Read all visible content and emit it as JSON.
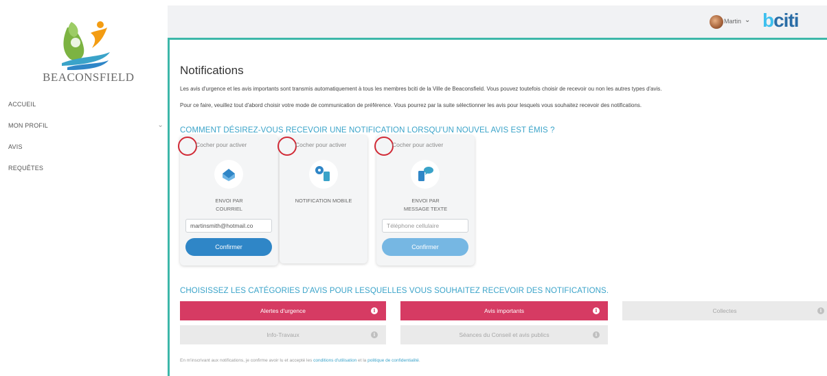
{
  "sidebar": {
    "logo_text": "BEACONSFIELD",
    "items": [
      {
        "label": "ACCUEIL"
      },
      {
        "label": "MON PROFIL"
      },
      {
        "label": "AVIS"
      },
      {
        "label": "REQUÊTES"
      }
    ]
  },
  "header": {
    "user_name": "Martin",
    "brand": {
      "b": "b",
      "rest": "citi"
    }
  },
  "main": {
    "title": "Notifications",
    "intro_line1": "Les avis d'urgence et les avis importants sont transmis automatiquement à tous les membres bciti de la Ville de Beaconsfield. Vous pouvez toutefois choisir de recevoir ou non les autres types d'avis.",
    "intro_line2": "Pour ce faire, veuillez tout d'abord choisir votre mode de communication de préférence. Vous pourrez par la suite sélectionner les avis pour lesquels vous souhaitez recevoir des notifications.",
    "comm_section_title": "COMMENT DÉSIREZ-VOUS RECEVOIR UNE NOTIFICATION LORSQU'UN NOUVEL AVIS EST ÉMIS ?",
    "cards": [
      {
        "checkbox_label": "Cocher pour activer",
        "label_line1": "ENVOI PAR",
        "label_line2": "COURRIEL",
        "input_value": "martinsmith@hotmail.co",
        "button_label": "Confirmer",
        "icon": "envelope-icon"
      },
      {
        "checkbox_label": "Cocher pour activer",
        "label_line1": "NOTIFICATION MOBILE",
        "icon": "mobile-notification-icon"
      },
      {
        "checkbox_label": "Cocher pour activer",
        "label_line1": "ENVOI PAR",
        "label_line2": "MESSAGE TEXTE",
        "input_placeholder": "Téléphone cellulaire",
        "button_label": "Confirmer",
        "icon": "sms-icon"
      }
    ],
    "cat_section_title": "CHOISISSEZ LES CATÉGORIES D'AVIS POUR LESQUELLES VOUS SOUHAITEZ RECEVOIR DES NOTIFICATIONS.",
    "categories": [
      {
        "label": "Alertes d'urgence",
        "active": true
      },
      {
        "label": "Avis importants",
        "active": true
      },
      {
        "label": "Collectes",
        "active": false
      },
      {
        "label": "Info-Travaux",
        "active": false
      },
      {
        "label": "Séances du Conseil et avis publics",
        "active": false
      }
    ],
    "footer": {
      "prefix": "En m'inscrivant aux notifications, je confirme avoir lu et accepté les ",
      "link1": "conditions d'utilisation",
      "middle": " et la ",
      "link2": "politique de confidentialité",
      "suffix": "."
    }
  },
  "colors": {
    "accent_teal": "#3db7a9",
    "section_blue": "#3aa3c9",
    "active_category": "#d63b63",
    "primary_button": "#2f86c7",
    "highlight_circle": "#d12a36"
  }
}
